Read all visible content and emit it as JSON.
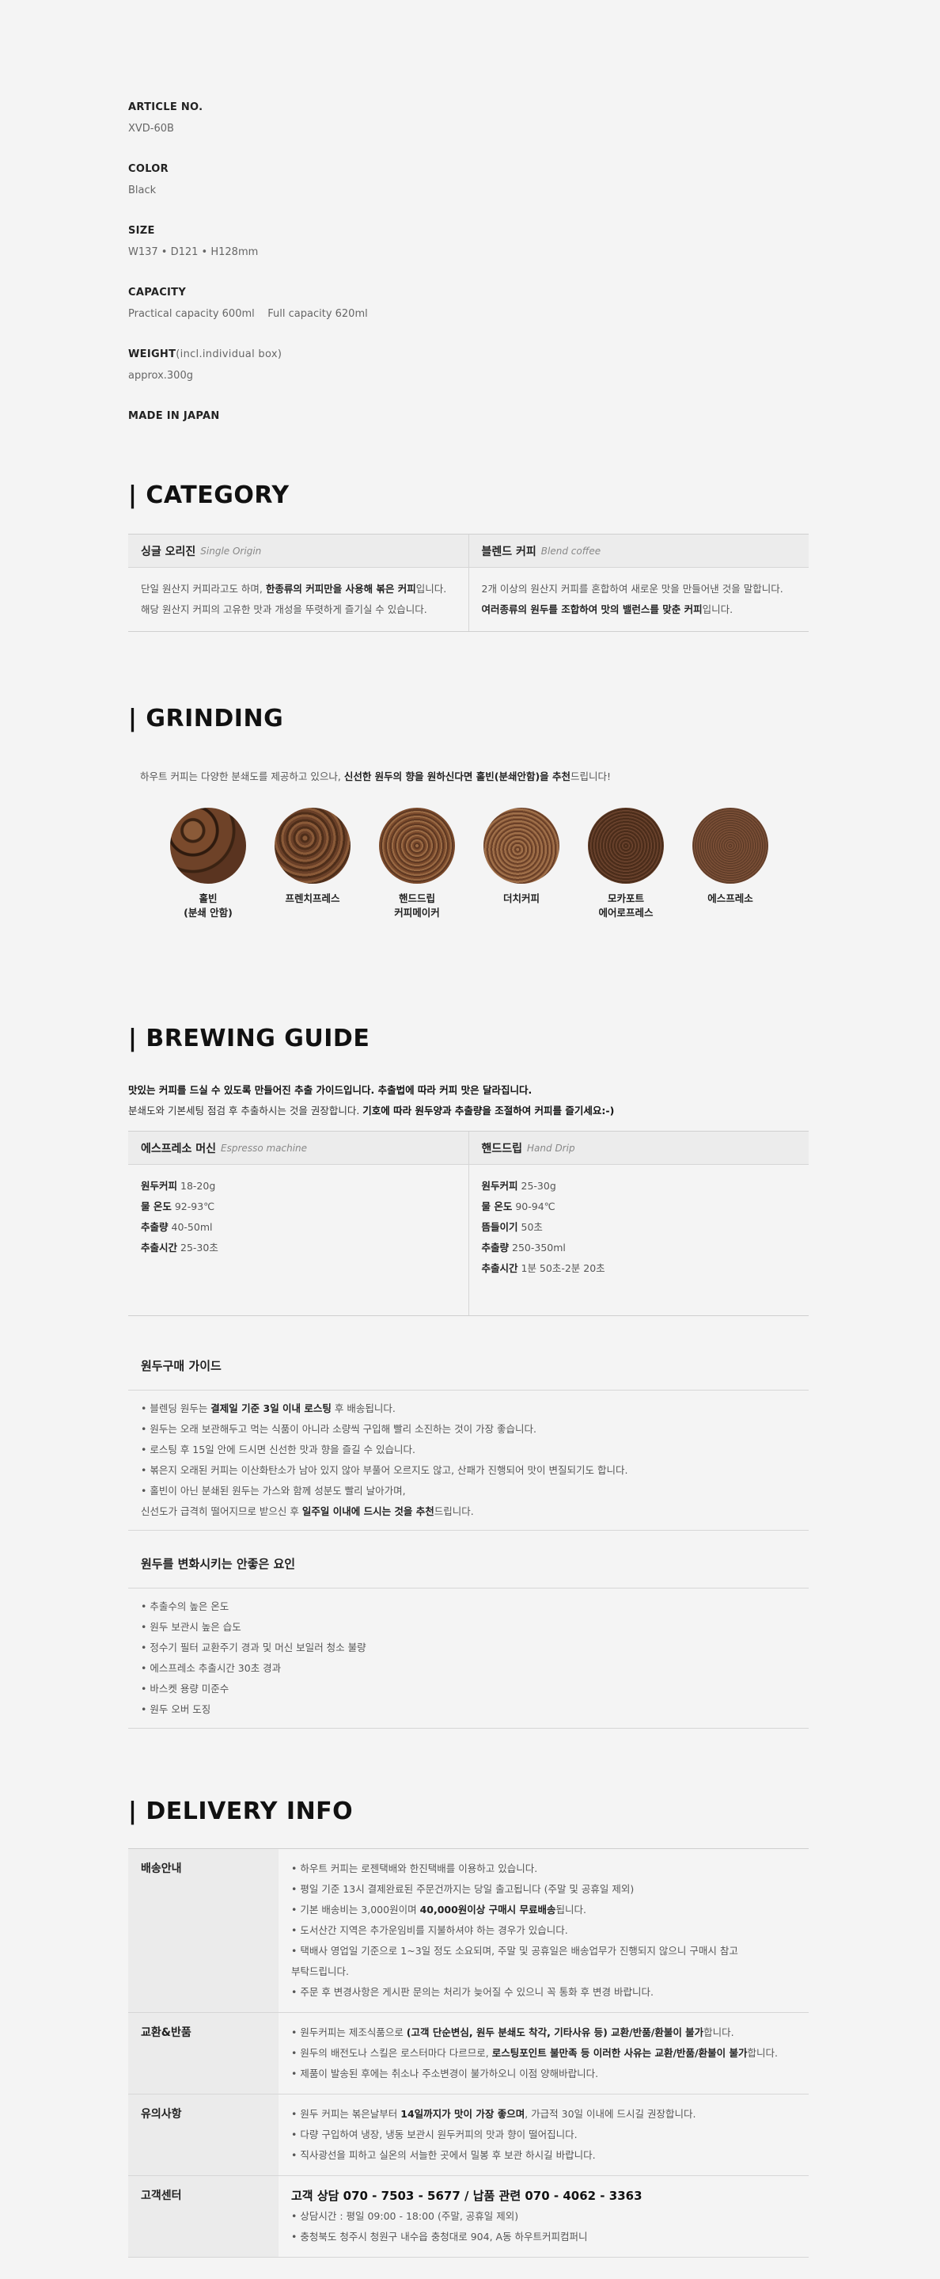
{
  "specs": [
    {
      "label": "ARTICLE NO.",
      "sub": "",
      "value": "XVD-60B"
    },
    {
      "label": "COLOR",
      "sub": "",
      "value": "Black"
    },
    {
      "label": "SIZE",
      "sub": "",
      "value": "W137 • D121 • H128mm"
    },
    {
      "label": "CAPACITY",
      "sub": "",
      "value": "Practical capacity 600ml    Full capacity 620ml"
    },
    {
      "label": "WEIGHT",
      "sub": "(incl.individual box)",
      "value": "approx.300g"
    },
    {
      "label": "MADE IN JAPAN",
      "sub": "",
      "value": ""
    }
  ],
  "category": {
    "title": "| CATEGORY",
    "col1_title": "싱글 오리진",
    "col1_sub": "Single Origin",
    "col1_line1_a": "단일 원산지 커피라고도 하며, ",
    "col1_line1_b": "한종류의 커피만을 사용해 볶은 커피",
    "col1_line1_c": "입니다.",
    "col1_line2": "해당 원산지 커피의 고유한 맛과 개성을 뚜렷하게 즐기실 수 있습니다.",
    "col2_title": "블렌드 커피",
    "col2_sub": "Blend coffee",
    "col2_line1": "2개 이상의 원산지 커피를 혼합하여 새로운 맛을 만들어낸 것을 말합니다.",
    "col2_line2_a": "여러종류의 원두를 조합하여 맛의 밸런스를 맞춘 커피",
    "col2_line2_b": "입니다."
  },
  "grinding": {
    "title": "| GRINDING",
    "intro_a": "하우트 커피는 다양한 분쇄도를 제공하고 있으나, ",
    "intro_b": "신선한 원두의 향을 원하신다면 홀빈(분쇄안함)을 추천",
    "intro_c": "드립니다!",
    "items": [
      {
        "label": "홀빈\n(분쇄 안함)",
        "color": "#5a3420"
      },
      {
        "label": "프렌치프레스",
        "color": "#6a4028"
      },
      {
        "label": "핸드드립\n커피메이커",
        "color": "#7a4a2c"
      },
      {
        "label": "더치커피",
        "color": "#7e4e30"
      },
      {
        "label": "모카포트\n에어로프레스",
        "color": "#5e3a24"
      },
      {
        "label": "에스프레소",
        "color": "#6e4530"
      }
    ]
  },
  "brewing": {
    "title": "| BREWING GUIDE",
    "intro1": "맛있는 커피를 드실 수 있도록 만들어진 추출 가이드입니다. 추출법에 따라 커피 맛은 달라집니다.",
    "intro2_a": "분쇄도와 기본세팅 점검 후 추출하시는 것을 권장합니다. ",
    "intro2_b": "기호에 따라 원두양과 추출량을 조절하여 커피를 즐기세요:-)",
    "col1_title": "에스프레소 머신",
    "col1_sub": "Espresso machine",
    "col1_rows": [
      {
        "k": "원두커피",
        "v": "18-20g"
      },
      {
        "k": "물 온도",
        "v": "92-93℃"
      },
      {
        "k": "추출량",
        "v": "40-50ml"
      },
      {
        "k": "추출시간",
        "v": "25-30초"
      }
    ],
    "col2_title": "핸드드립",
    "col2_sub": "Hand Drip",
    "col2_rows": [
      {
        "k": "원두커피",
        "v": "25-30g"
      },
      {
        "k": "물 온도",
        "v": "90-94℃"
      },
      {
        "k": "뜸들이기",
        "v": "50초"
      },
      {
        "k": "추출량",
        "v": "250-350ml"
      },
      {
        "k": "추출시간",
        "v": "1분 50초-2분 20초"
      }
    ]
  },
  "purchase_guide": {
    "title": "원두구매 가이드",
    "line1_a": "• 블렌딩 원두는 ",
    "line1_b": "결제일 기준 3일 이내 로스팅",
    "line1_c": " 후 배송됩니다.",
    "line2": "• 원두는 오래 보관해두고 먹는 식품이 아니라 소량씩 구입해 빨리 소진하는 것이 가장 좋습니다.",
    "line3": "• 로스팅 후 15일 안에 드시면 신선한 맛과 향을 즐길 수 있습니다.",
    "line4": "• 볶은지 오래된 커피는 이산화탄소가 남아 있지 않아 부풀어 오르지도 않고, 산패가 진행되어 맛이 변질되기도 합니다.",
    "line5": "• 홀빈이 아닌 분쇄된 원두는 가스와 함께 성분도 빨리 날아가며,",
    "line6_a": "신선도가 급격히 떨어지므로 받으신 후 ",
    "line6_b": "일주일 이내에 드시는 것을 추천",
    "line6_c": "드립니다."
  },
  "factors": {
    "title": "원두를 변화시키는 안좋은 요인",
    "items": [
      "• 추출수의 높은 온도",
      "• 원두 보관시 높은 습도",
      "• 정수기 필터 교환주기 경과 및 머신 보일러 청소 불량",
      "• 에스프레소 추출시간 30초 경과",
      "• 바스켓 용량 미준수",
      "• 원두 오버 도징"
    ]
  },
  "delivery": {
    "title": "| DELIVERY INFO",
    "shipping_label": "배송안내",
    "shipping_1": "• 하우트 커피는 로젠택배와 한진택배를 이용하고 있습니다.",
    "shipping_2": "• 평일 기준 13시 결제완료된 주문건까지는 당일 출고됩니다 (주말 및 공휴일 제외)",
    "shipping_3_a": "• 기본 배송비는 3,000원이며 ",
    "shipping_3_b": "40,000원이상 구매시 무료배송",
    "shipping_3_c": "됩니다.",
    "shipping_4": "• 도서산간 지역은 추가운임비를 지불하셔야 하는 경우가 있습니다.",
    "shipping_5": "• 택배사 영업일 기준으로 1~3일 정도 소요되며, 주말 및 공휴일은 배송업무가 진행되지 않으니 구매시 참고",
    "shipping_5b": "부탁드립니다.",
    "shipping_6": "• 주문 후 변경사항은 게시판 문의는 처리가 늦어질 수 있으니 꼭 통화 후 변경 바랍니다.",
    "return_label": "교환&반품",
    "return_1_a": "• 원두커피는 제조식품으로 ",
    "return_1_b": "(고객 단순변심, 원두 분쇄도 착각, 기타사유 등) 교환/반품/환불이 불가",
    "return_1_c": "합니다.",
    "return_2_a": "• 원두의 배전도나 스킬은 로스터마다 다르므로, ",
    "return_2_b": "로스팅포인트 불만족 등 이러한 사유는 교환/반품/환불이 불가",
    "return_2_c": "합니다.",
    "return_3": "• 제품이 발송된 후에는 취소나 주소변경이 불가하오니 이점 양해바랍니다.",
    "notice_label": "유의사항",
    "notice_1_a": "• 원두 커피는 볶은날부터 ",
    "notice_1_b": "14일까지가 맛이 가장 좋으며",
    "notice_1_c": ", 가급적 30일 이내에 드시길 권장합니다.",
    "notice_2": "• 다량 구입하여 냉장, 냉동 보관시 원두커피의 맛과 향이 떨어집니다.",
    "notice_3": "• 직사광선을 피하고 실온의 서늘한 곳에서 밀봉 후 보관 하시길 바랍니다.",
    "cs_label": "고객센터",
    "cs_phone": "고객 상담 070 - 7503 - 5677 / 납품 관련 070 - 4062 - 3363",
    "cs_hours": "• 상담시간 : 평일 09:00 - 18:00 (주말, 공휴일 제외)",
    "cs_address": "• 충청북도 청주시 청원구 내수읍 충청대로 904, A동 하우트커피컴퍼니"
  }
}
